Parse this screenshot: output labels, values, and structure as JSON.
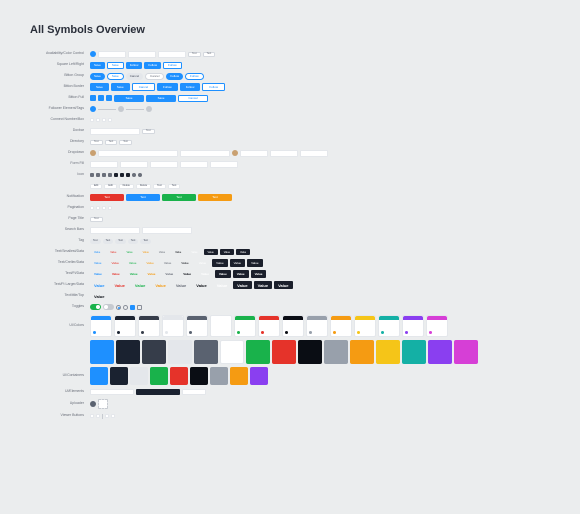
{
  "title": "All Symbols Overview",
  "sections": {
    "availabilityControl": "Availability/Color Control",
    "squareButtons": "Square Left/Right",
    "bittonGroup": "Bitton Group",
    "bittonBorder": "Bitton Border",
    "bittonFull": "Bitton Full",
    "followerTogs": "Follower Element/Tags",
    "connectNumber": "Connect Number/Box",
    "dovbar": "Dovbar",
    "directory": "Directory",
    "dropdown": "Dropdown",
    "formFill": "Form Fill",
    "icon": "Icon",
    "notification": "Notification",
    "pagination": "Pagination",
    "pageTitle": "Page Title",
    "searchBars": "Search Bars",
    "tags": "Tag",
    "textSmallestData": "Text/Smallest/Data",
    "textCrellerData": "Text/Creller/Data",
    "textFtData": "Text/Ft/Data",
    "textFtLargerData": "Text/Ft Larger/Data",
    "textTitleTop": "Text/title/Top",
    "toggles": "Toggles",
    "uiColors": "UI/Colors",
    "uiContainers": "UI/Containers",
    "uiElements": "UI/Elements",
    "uploader": "Uploader",
    "viewerBtns": "Viewer Buttons"
  },
  "labels": {
    "value": "Value",
    "text": "Text",
    "save": "Save",
    "cancel": "Cancel",
    "follow": "Follow",
    "edit": "Edit",
    "delete": "Delete"
  },
  "colors": {
    "blue": "#1e90ff",
    "navy": "#1a2230",
    "slate": "#363d4a",
    "grayL": "#e4e7eb",
    "grayM": "#98a0ab",
    "grayD": "#5a6270",
    "white": "#ffffff",
    "green": "#19b24b",
    "red": "#e5332a",
    "orange": "#f59b12",
    "yellow": "#f5c518",
    "teal": "#14b0a5",
    "purple": "#8a3ff0",
    "magenta": "#d63fd6",
    "pink": "#f04c8a",
    "black": "#0a0d14"
  },
  "swatches": [
    "blue",
    "navy",
    "slate",
    "grayL",
    "grayD",
    "white",
    "green",
    "red",
    "black",
    "grayM",
    "orange",
    "yellow",
    "teal",
    "purple",
    "magenta"
  ],
  "swatches2": [
    "blue",
    "navy",
    "grayL",
    "green",
    "red",
    "black",
    "grayM",
    "orange",
    "purple"
  ],
  "textColors": [
    "#1e90ff",
    "#e5332a",
    "#19b24b",
    "#f59b12",
    "#6a6f7a",
    "#0a0d14",
    "#ffffff"
  ]
}
